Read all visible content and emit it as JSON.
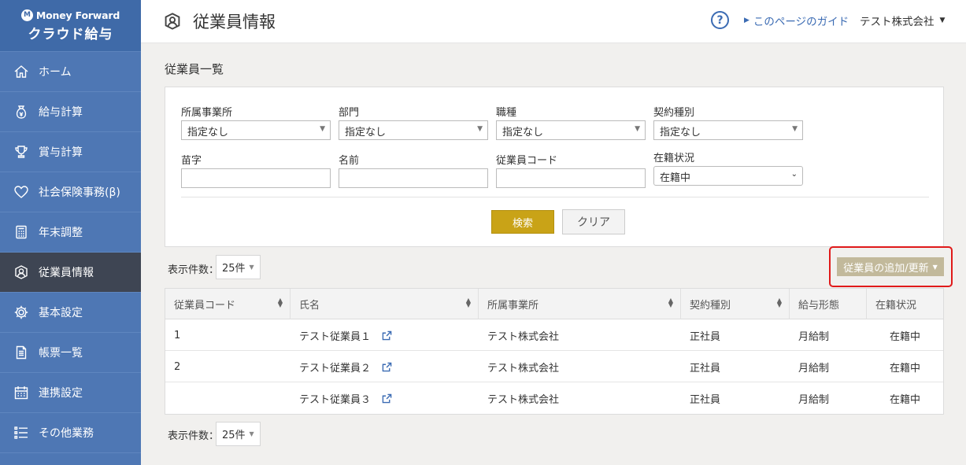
{
  "brand": {
    "top": "Money Forward",
    "bottom": "クラウド給与"
  },
  "sidebar": {
    "items": [
      {
        "label": "ホーム",
        "icon": "home-icon"
      },
      {
        "label": "給与計算",
        "icon": "money-bag-icon"
      },
      {
        "label": "賞与計算",
        "icon": "trophy-icon"
      },
      {
        "label": "社会保険事務(β)",
        "icon": "heart-icon"
      },
      {
        "label": "年末調整",
        "icon": "calculator-icon"
      },
      {
        "label": "従業員情報",
        "icon": "employee-icon",
        "active": true
      },
      {
        "label": "基本設定",
        "icon": "gear-icon"
      },
      {
        "label": "帳票一覧",
        "icon": "document-icon"
      },
      {
        "label": "連携設定",
        "icon": "calendar-icon"
      },
      {
        "label": "その他業務",
        "icon": "list-icon"
      }
    ]
  },
  "header": {
    "title": "従業員情報",
    "help": "?",
    "guide": "このページのガイド",
    "company": "テスト株式会社"
  },
  "main": {
    "section_title": "従業員一覧",
    "filters": {
      "office_label": "所属事業所",
      "office_value": "指定なし",
      "dept_label": "部門",
      "dept_value": "指定なし",
      "job_label": "職種",
      "job_value": "指定なし",
      "contract_label": "契約種別",
      "contract_value": "指定なし",
      "surname_label": "苗字",
      "name_label": "名前",
      "code_label": "従業員コード",
      "status_label": "在籍状況",
      "status_value": "在籍中"
    },
    "search_button": "検索",
    "clear_button": "クリア",
    "per_page_label": "表示件数：",
    "per_page_value": "25件",
    "add_button": "従業員の追加/更新",
    "table": {
      "headers": [
        "従業員コード",
        "氏名",
        "所属事業所",
        "契約種別",
        "給与形態",
        "在籍状況"
      ],
      "rows": [
        [
          "1",
          "テスト従業員１",
          "テスト株式会社",
          "正社員",
          "月給制",
          "在籍中"
        ],
        [
          "2",
          "テスト従業員２",
          "テスト株式会社",
          "正社員",
          "月給制",
          "在籍中"
        ],
        [
          "",
          "テスト従業員３",
          "テスト株式会社",
          "正社員",
          "月給制",
          "在籍中"
        ]
      ]
    }
  },
  "colors": {
    "sidebar": "#4e77b4",
    "active": "#3e4553",
    "search": "#c9a317",
    "highlight": "#e01a1a"
  }
}
